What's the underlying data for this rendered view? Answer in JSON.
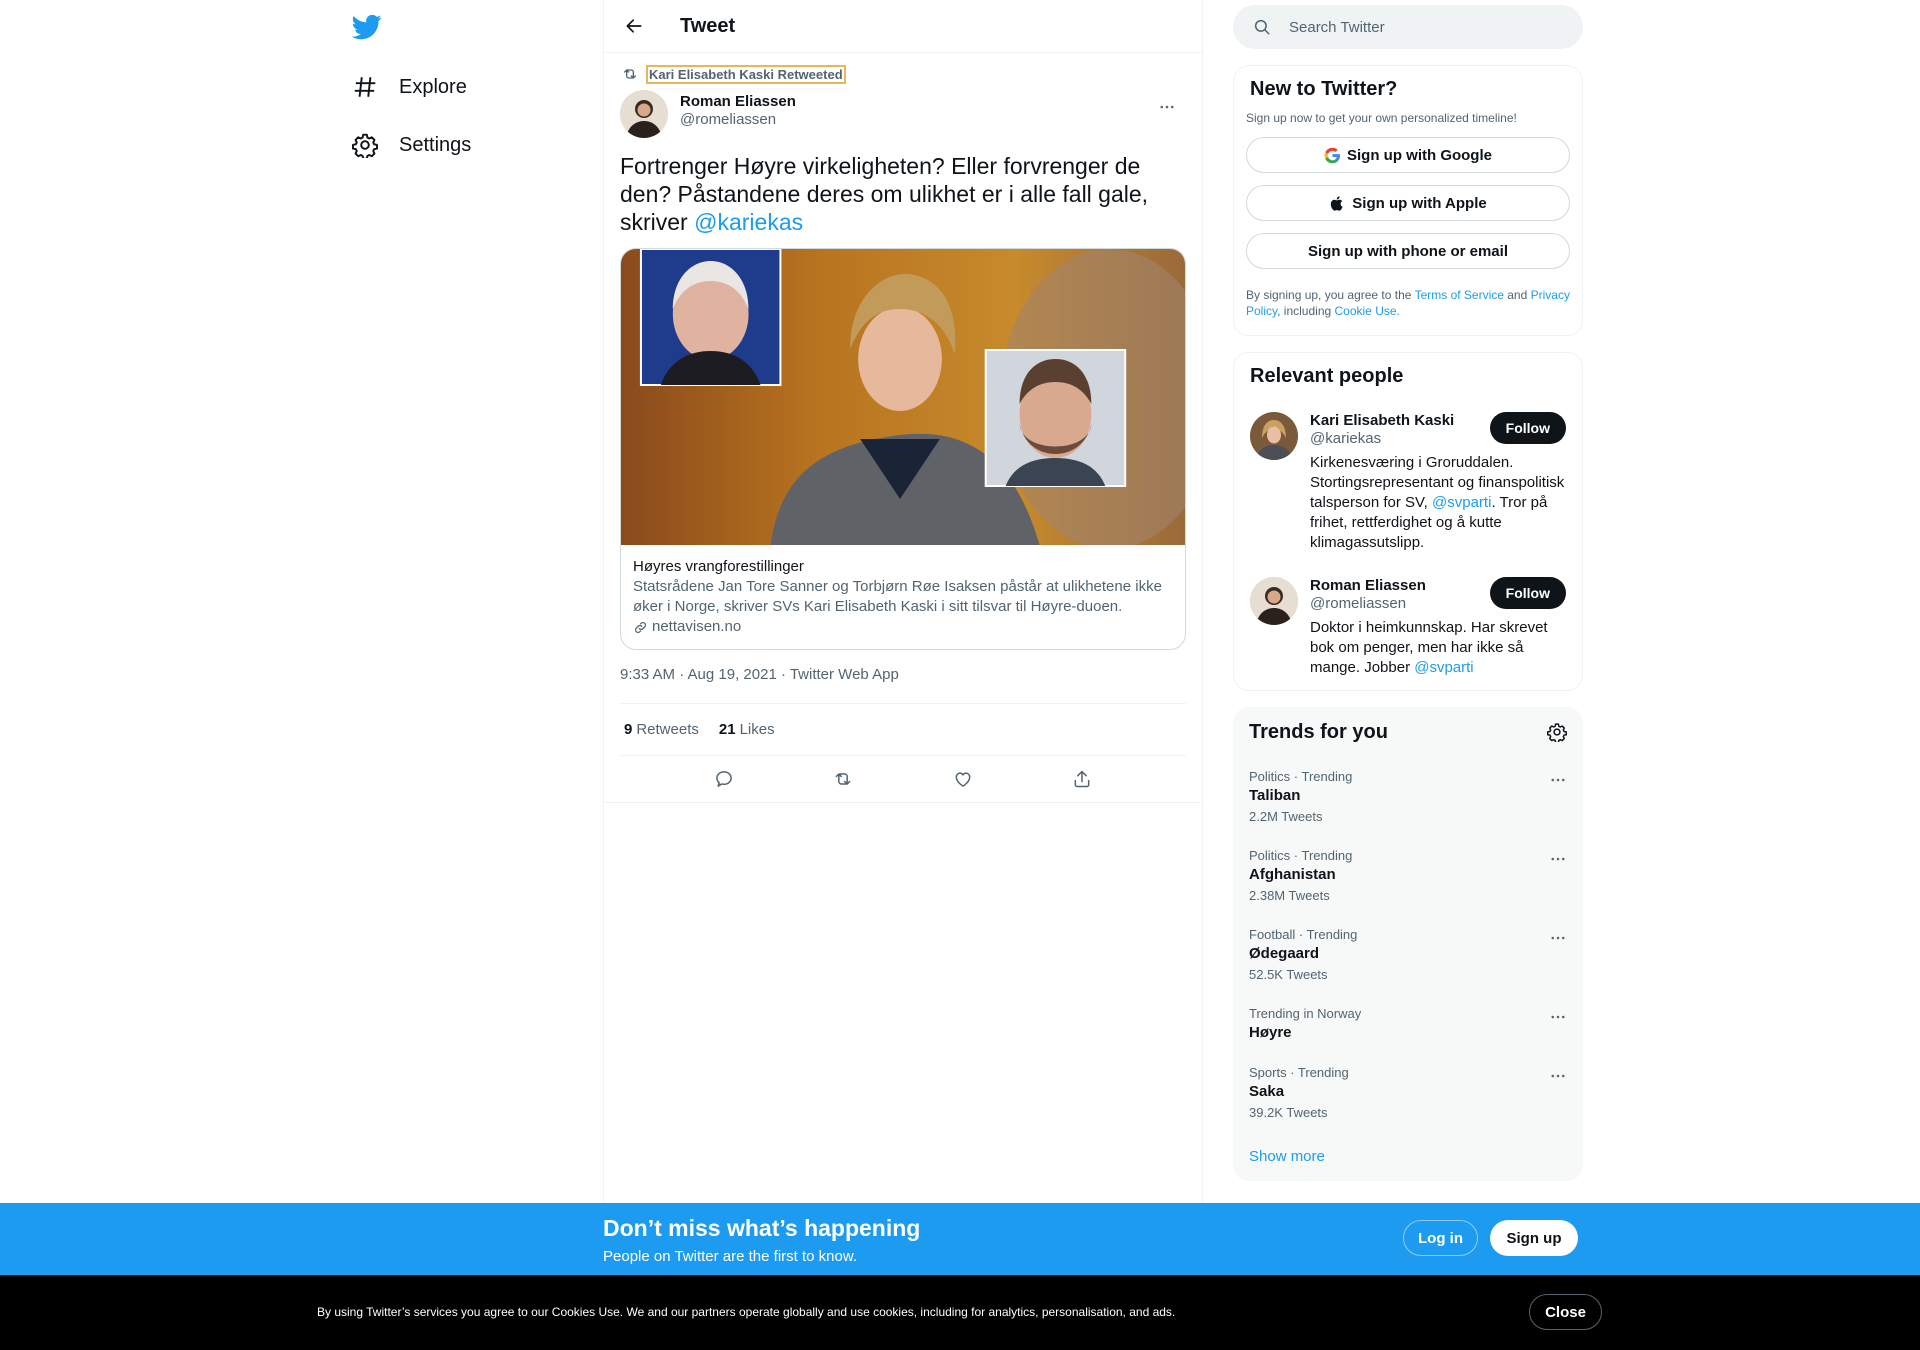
{
  "nav": {
    "logo_icon": "twitter-bird-icon",
    "items": [
      {
        "label": "Explore",
        "icon": "hashtag-icon"
      },
      {
        "label": "Settings",
        "icon": "gear-icon"
      }
    ]
  },
  "header": {
    "title": "Tweet"
  },
  "tweet": {
    "retweeted_by": "Kari Elisabeth Kaski Retweeted",
    "author_name": "Roman Eliassen",
    "author_handle": "@romeliassen",
    "text_main": "Fortrenger Høyre virkeligheten? Eller forvrenger de den? Påstandene deres om ulikhet er i alle fall gale, skriver ",
    "text_mention": "@kariekas",
    "card": {
      "title": "Høyres vrangforestillinger",
      "description": "Statsrådene Jan Tore Sanner og Torbjørn Røe Isaksen påstår at ulikhetene ikke øker i Norge, skriver SVs Kari Elisabeth Kaski i sitt tilsvar til Høyre-duoen.",
      "domain": "nettavisen.no"
    },
    "timestamp": "9:33 AM · Aug 19, 2021 · Twitter Web App",
    "retweets_count": "9",
    "retweets_label": "Retweets",
    "likes_count": "21",
    "likes_label": "Likes"
  },
  "search": {
    "placeholder": "Search Twitter"
  },
  "signup_box": {
    "title": "New to Twitter?",
    "subtitle": "Sign up now to get your own personalized timeline!",
    "google": "Sign up with Google",
    "apple": "Sign up with Apple",
    "phone": "Sign up with phone or email",
    "legal_1": "By signing up, you agree to the ",
    "terms": "Terms of Service",
    "legal_2": " and ",
    "privacy": "Privacy Policy",
    "legal_3": ", including ",
    "cookie": "Cookie Use."
  },
  "relevant": {
    "title": "Relevant people",
    "people": [
      {
        "name": "Kari Elisabeth Kaski",
        "handle": "@kariekas",
        "bio_1": "Kirkenesværing i Groruddalen. Stortingsrepresentant og finanspolitisk talsperson for SV, ",
        "bio_mention": "@svparti",
        "bio_2": ". Tror på frihet, rettferdighet og å kutte klimagassutslipp.",
        "follow": "Follow"
      },
      {
        "name": "Roman Eliassen",
        "handle": "@romeliassen",
        "bio_1": "Doktor i heimkunnskap. Har skrevet bok om penger, men har ikke så mange. Jobber ",
        "bio_mention": "@svparti",
        "bio_2": "",
        "follow": "Follow"
      }
    ]
  },
  "trends": {
    "title": "Trends for you",
    "items": [
      {
        "context": "Politics · Trending",
        "name": "Taliban",
        "count": "2.2M Tweets"
      },
      {
        "context": "Politics · Trending",
        "name": "Afghanistan",
        "count": "2.38M Tweets"
      },
      {
        "context": "Football · Trending",
        "name": "Ødegaard",
        "count": "52.5K Tweets"
      },
      {
        "context": "Trending in Norway",
        "name": "Høyre",
        "count": ""
      },
      {
        "context": "Sports · Trending",
        "name": "Saka",
        "count": "39.2K Tweets"
      }
    ],
    "show_more": "Show more"
  },
  "banner": {
    "title": "Don’t miss what’s happening",
    "subtitle": "People on Twitter are the first to know.",
    "login": "Log in",
    "signup": "Sign up"
  },
  "cookie_bar": {
    "text": "By using Twitter’s services you agree to our Cookies Use. We and our partners operate globally and use cookies, including for analytics, personalisation, and ads.",
    "close": "Close"
  },
  "colors": {
    "accent": "#1d9bf0",
    "text": "#0f1419",
    "muted": "#536471"
  }
}
